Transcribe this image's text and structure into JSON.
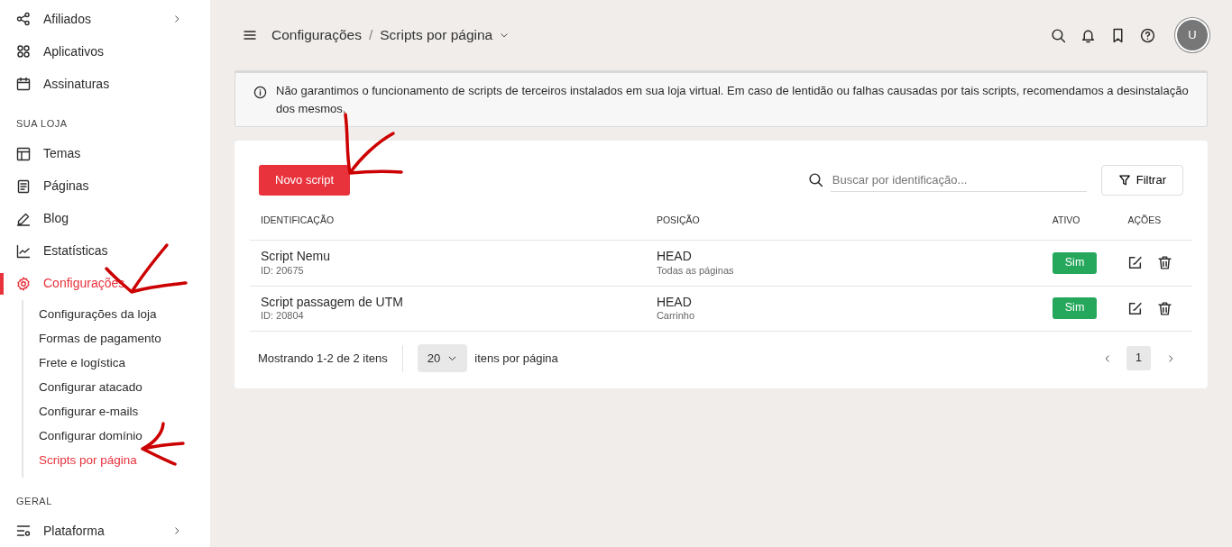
{
  "sidebar": {
    "sections": [
      {
        "items": [
          {
            "label": "Afiliados",
            "expanded": false,
            "selected": false
          },
          {
            "label": "Aplicativos",
            "selected": false
          },
          {
            "label": "Assinaturas",
            "selected": false
          }
        ]
      },
      {
        "title": "SUA LOJA",
        "items": [
          {
            "label": "Temas",
            "selected": false
          },
          {
            "label": "Páginas",
            "selected": false
          },
          {
            "label": "Blog",
            "selected": false
          },
          {
            "label": "Estatísticas",
            "selected": false
          },
          {
            "label": "Configurações",
            "expanded": true,
            "selected": true,
            "children": [
              {
                "label": "Configurações da loja",
                "selected": false
              },
              {
                "label": "Formas de pagamento",
                "selected": false
              },
              {
                "label": "Frete e logística",
                "selected": false
              },
              {
                "label": "Configurar atacado",
                "selected": false
              },
              {
                "label": "Configurar e-mails",
                "selected": false
              },
              {
                "label": "Configurar domínio",
                "selected": false
              },
              {
                "label": "Scripts por página",
                "selected": true
              }
            ]
          }
        ]
      },
      {
        "title": "GERAL",
        "items": [
          {
            "label": "Plataforma",
            "expanded": false,
            "selected": false
          }
        ]
      }
    ]
  },
  "header": {
    "breadcrumb": [
      "Configurações",
      "Scripts por página"
    ],
    "separator": "/",
    "avatar": "U"
  },
  "alert": "Não garantimos o funcionamento de scripts de terceiros instalados em sua loja virtual. Em caso de lentidão ou falhas causadas por tais scripts, recomendamos a desinstalação dos mesmos.",
  "toolbar": {
    "new_button": "Novo script",
    "search": {
      "placeholder": "Buscar por identificação..."
    },
    "filter_button": "Filtrar"
  },
  "table": {
    "columns": [
      "IDENTIFICAÇÃO",
      "POSIÇÃO",
      "ATIVO",
      "AÇÕES"
    ],
    "rows": [
      {
        "name": "Script Nemu",
        "id": "ID: 20675",
        "position": "HEAD",
        "pages": "Todas as páginas",
        "active": "Sim"
      },
      {
        "name": "Script passagem de UTM",
        "id": "ID: 20804",
        "position": "HEAD",
        "pages": "Carrinho",
        "active": "Sim"
      }
    ]
  },
  "pagination": {
    "summary": "Mostrando 1-2 de 2 itens",
    "per_page": "20",
    "per_page_label": "itens por página",
    "pages": [
      {
        "label": "1",
        "selected": true
      }
    ]
  }
}
